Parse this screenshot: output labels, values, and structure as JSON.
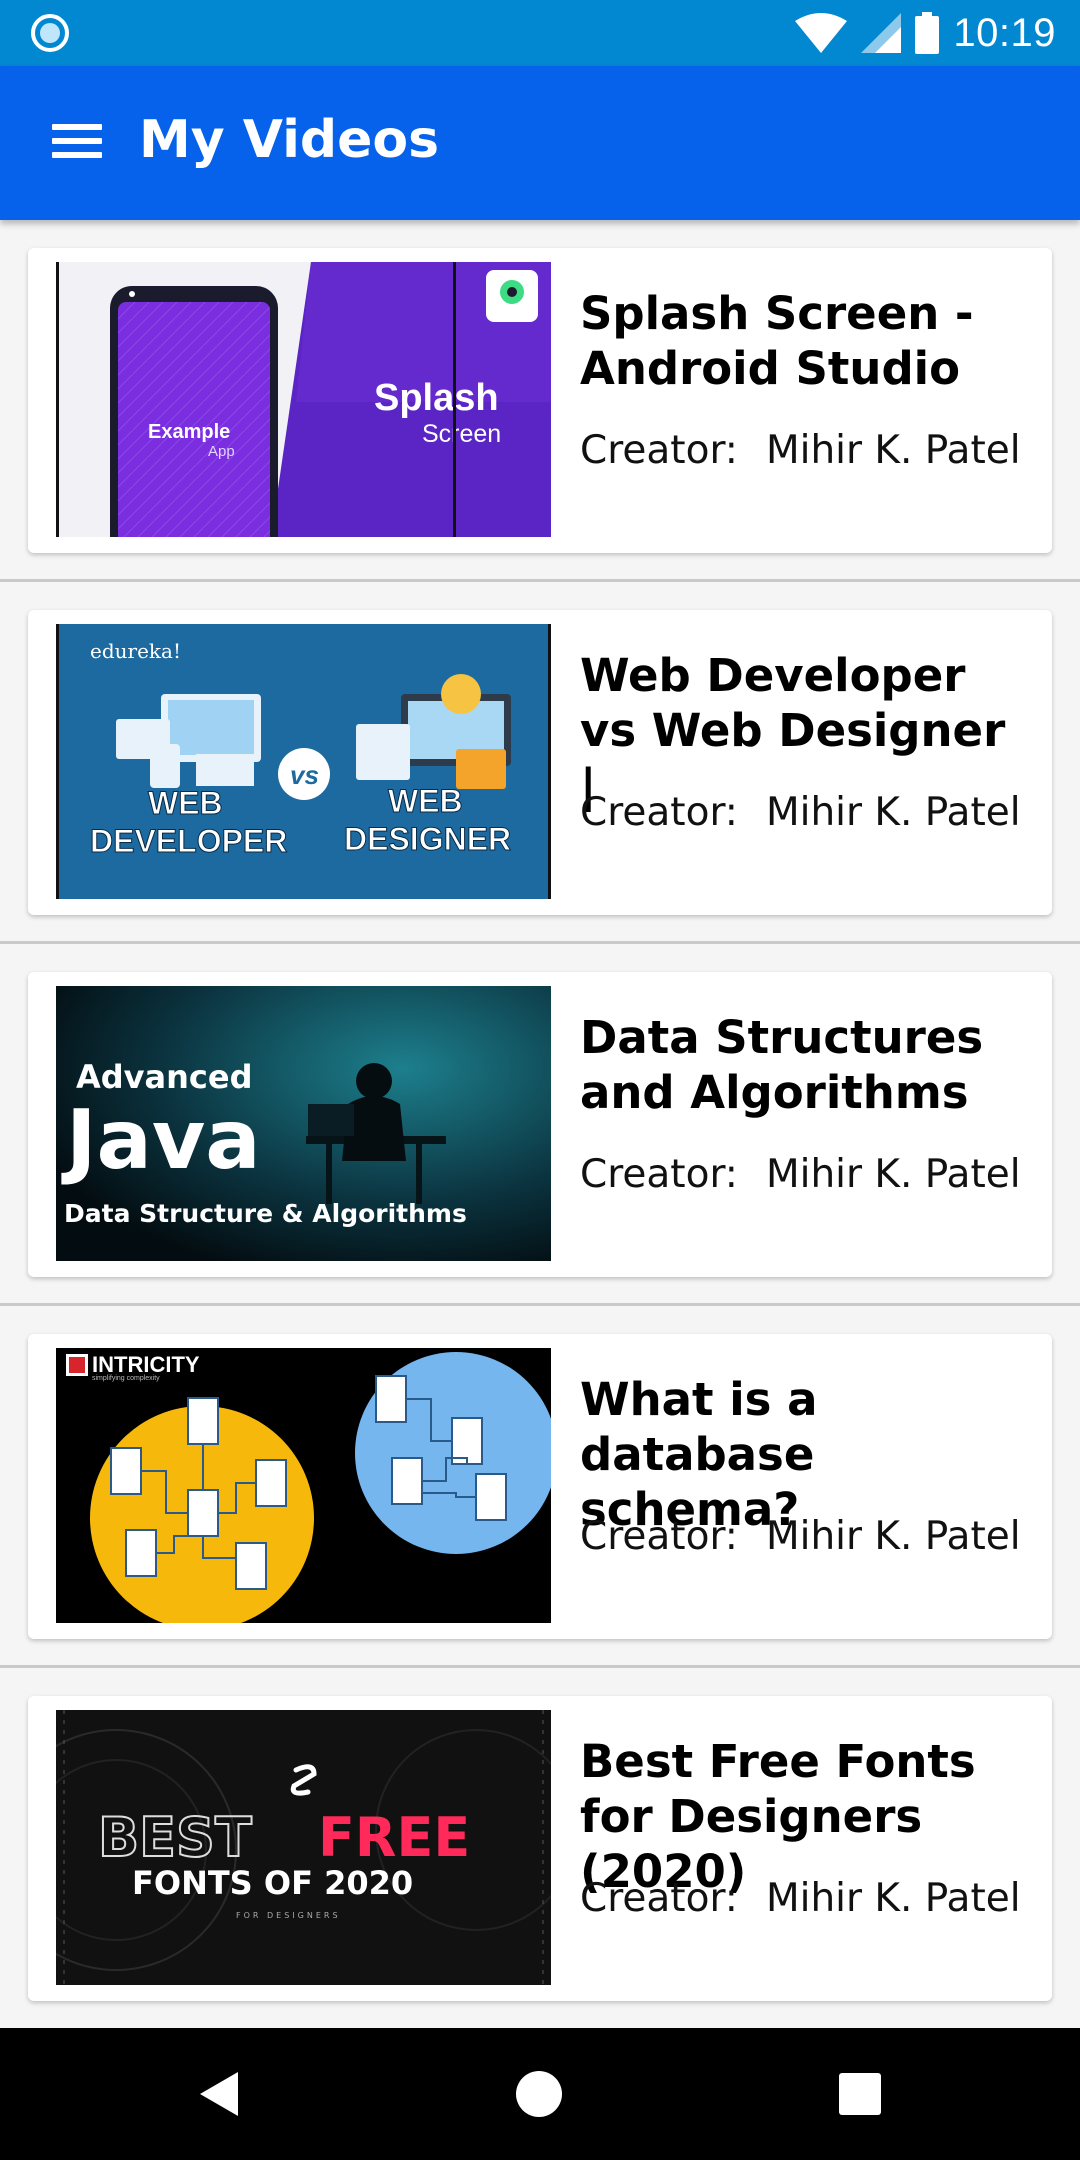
{
  "status_bar": {
    "time": "10:19",
    "icons": [
      "notification-dot-icon",
      "wifi-icon",
      "signal-icon",
      "battery-icon"
    ],
    "color": "#0288d1"
  },
  "app_bar": {
    "title": "My Videos",
    "menu_icon": "hamburger-menu-icon",
    "color": "#0662ea"
  },
  "videos": [
    {
      "title": "Splash Screen - Android Studio",
      "creator_label": "Creator:",
      "creator_name": "Mihir K. Patel",
      "thumb": {
        "line1": "Example",
        "line2": "App",
        "line3": "Splash",
        "line4": "Screen"
      }
    },
    {
      "title": "Web Developer vs Web Designer |",
      "creator_label": "Creator:",
      "creator_name": "Mihir K. Patel",
      "thumb": {
        "brand": "edureka!",
        "left_top": "WEB",
        "left_bottom": "DEVELOPER",
        "vs": "vs",
        "right_top": "WEB",
        "right_bottom": "DESIGNER"
      }
    },
    {
      "title": "Data Structures and Algorithms",
      "creator_label": "Creator:",
      "creator_name": "Mihir K. Patel",
      "thumb": {
        "line1": "Advanced",
        "line2": "Java",
        "line3": "Data Structure & Algorithms"
      }
    },
    {
      "title": "What is a database schema?",
      "creator_label": "Creator:",
      "creator_name": "Mihir K. Patel",
      "thumb": {
        "brand": "INTRICITY",
        "tagline": "simplifying complexity"
      }
    },
    {
      "title": "Best Free Fonts for Designers (2020)",
      "creator_label": "Creator:",
      "creator_name": "Mihir K. Patel",
      "thumb": {
        "word1": "BEST",
        "word2": "FREE",
        "line2": "FONTS OF 2020",
        "line3": "FOR DESIGNERS"
      }
    }
  ],
  "nav_bar": {
    "back_icon": "back-triangle-icon",
    "home_icon": "home-circle-icon",
    "recents_icon": "recents-square-icon"
  }
}
